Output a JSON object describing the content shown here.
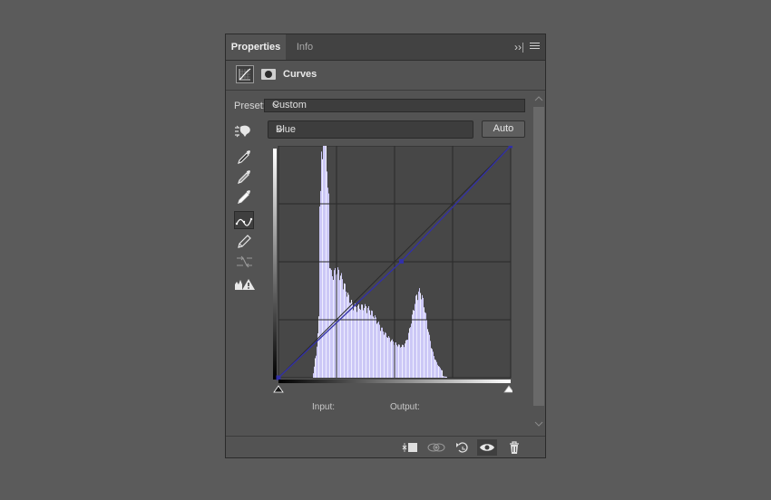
{
  "tabs": {
    "active": "Properties",
    "inactive": "Info"
  },
  "header": {
    "title": "Curves"
  },
  "preset": {
    "label": "Preset:",
    "value": "Custom"
  },
  "channel": {
    "value": "Blue"
  },
  "auto_button": {
    "label": "Auto"
  },
  "readouts": {
    "input_label": "Input:",
    "output_label": "Output:"
  },
  "colors": {
    "panel": "#535353",
    "graph": "#474747",
    "histogram": "#ccc8f6",
    "curve": "#3230a8"
  },
  "curve_points": [
    [
      0,
      0
    ],
    [
      135,
      128
    ],
    [
      255,
      255
    ]
  ]
}
